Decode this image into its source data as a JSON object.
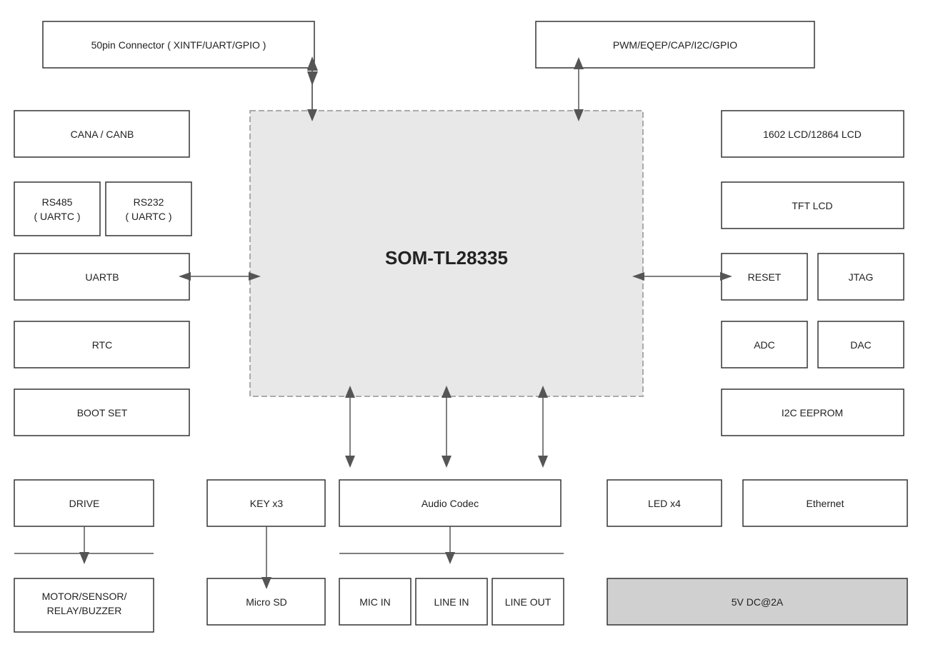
{
  "boxes": {
    "connector50pin": "50pin Connector ( XINTF/UART/GPIO )",
    "pwm": "PWM/EQEP/CAP/I2C/GPIO",
    "cana_canb": "CANA / CANB",
    "rs485": "RS485\n( UARTC )",
    "rs232": "RS232\n( UARTC )",
    "uartb": "UARTB",
    "rtc": "RTC",
    "boot_set": "BOOT SET",
    "som": "SOM-TL28335",
    "lcd1602": "1602 LCD/12864 LCD",
    "tft_lcd": "TFT LCD",
    "reset": "RESET",
    "jtag": "JTAG",
    "adc": "ADC",
    "dac": "DAC",
    "i2c_eeprom": "I2C EEPROM",
    "drive": "DRIVE",
    "key_x3": "KEY x3",
    "audio_codec": "Audio Codec",
    "led_x4": "LED x4",
    "ethernet": "Ethernet",
    "motor_sensor": "MOTOR/SENSOR/\nRELAY/BUZZER",
    "micro_sd": "Micro SD",
    "mic_in": "MIC IN",
    "line_in": "LINE IN",
    "line_out": "LINE OUT",
    "power": "5V DC@2A"
  }
}
